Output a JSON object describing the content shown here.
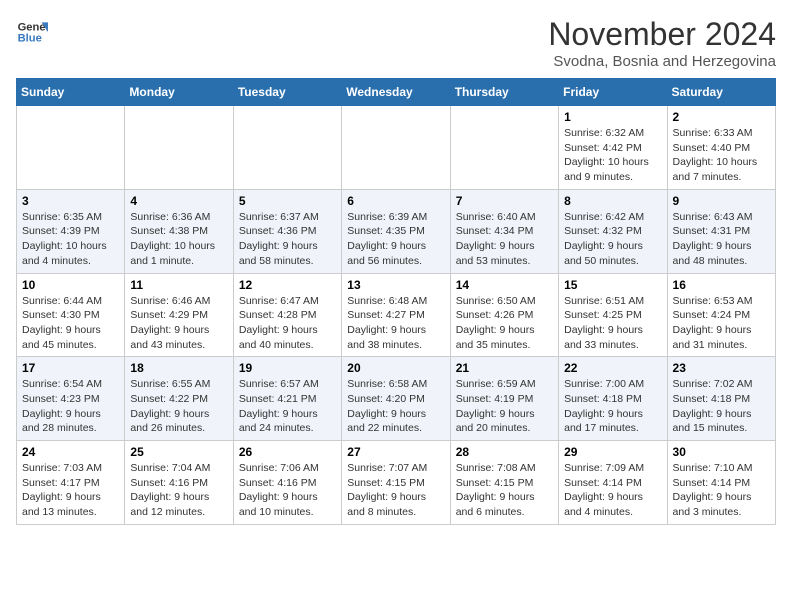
{
  "logo": {
    "line1": "General",
    "line2": "Blue"
  },
  "title": "November 2024",
  "location": "Svodna, Bosnia and Herzegovina",
  "weekdays": [
    "Sunday",
    "Monday",
    "Tuesday",
    "Wednesday",
    "Thursday",
    "Friday",
    "Saturday"
  ],
  "weeks": [
    [
      {
        "day": "",
        "info": ""
      },
      {
        "day": "",
        "info": ""
      },
      {
        "day": "",
        "info": ""
      },
      {
        "day": "",
        "info": ""
      },
      {
        "day": "",
        "info": ""
      },
      {
        "day": "1",
        "info": "Sunrise: 6:32 AM\nSunset: 4:42 PM\nDaylight: 10 hours and 9 minutes."
      },
      {
        "day": "2",
        "info": "Sunrise: 6:33 AM\nSunset: 4:40 PM\nDaylight: 10 hours and 7 minutes."
      }
    ],
    [
      {
        "day": "3",
        "info": "Sunrise: 6:35 AM\nSunset: 4:39 PM\nDaylight: 10 hours and 4 minutes."
      },
      {
        "day": "4",
        "info": "Sunrise: 6:36 AM\nSunset: 4:38 PM\nDaylight: 10 hours and 1 minute."
      },
      {
        "day": "5",
        "info": "Sunrise: 6:37 AM\nSunset: 4:36 PM\nDaylight: 9 hours and 58 minutes."
      },
      {
        "day": "6",
        "info": "Sunrise: 6:39 AM\nSunset: 4:35 PM\nDaylight: 9 hours and 56 minutes."
      },
      {
        "day": "7",
        "info": "Sunrise: 6:40 AM\nSunset: 4:34 PM\nDaylight: 9 hours and 53 minutes."
      },
      {
        "day": "8",
        "info": "Sunrise: 6:42 AM\nSunset: 4:32 PM\nDaylight: 9 hours and 50 minutes."
      },
      {
        "day": "9",
        "info": "Sunrise: 6:43 AM\nSunset: 4:31 PM\nDaylight: 9 hours and 48 minutes."
      }
    ],
    [
      {
        "day": "10",
        "info": "Sunrise: 6:44 AM\nSunset: 4:30 PM\nDaylight: 9 hours and 45 minutes."
      },
      {
        "day": "11",
        "info": "Sunrise: 6:46 AM\nSunset: 4:29 PM\nDaylight: 9 hours and 43 minutes."
      },
      {
        "day": "12",
        "info": "Sunrise: 6:47 AM\nSunset: 4:28 PM\nDaylight: 9 hours and 40 minutes."
      },
      {
        "day": "13",
        "info": "Sunrise: 6:48 AM\nSunset: 4:27 PM\nDaylight: 9 hours and 38 minutes."
      },
      {
        "day": "14",
        "info": "Sunrise: 6:50 AM\nSunset: 4:26 PM\nDaylight: 9 hours and 35 minutes."
      },
      {
        "day": "15",
        "info": "Sunrise: 6:51 AM\nSunset: 4:25 PM\nDaylight: 9 hours and 33 minutes."
      },
      {
        "day": "16",
        "info": "Sunrise: 6:53 AM\nSunset: 4:24 PM\nDaylight: 9 hours and 31 minutes."
      }
    ],
    [
      {
        "day": "17",
        "info": "Sunrise: 6:54 AM\nSunset: 4:23 PM\nDaylight: 9 hours and 28 minutes."
      },
      {
        "day": "18",
        "info": "Sunrise: 6:55 AM\nSunset: 4:22 PM\nDaylight: 9 hours and 26 minutes."
      },
      {
        "day": "19",
        "info": "Sunrise: 6:57 AM\nSunset: 4:21 PM\nDaylight: 9 hours and 24 minutes."
      },
      {
        "day": "20",
        "info": "Sunrise: 6:58 AM\nSunset: 4:20 PM\nDaylight: 9 hours and 22 minutes."
      },
      {
        "day": "21",
        "info": "Sunrise: 6:59 AM\nSunset: 4:19 PM\nDaylight: 9 hours and 20 minutes."
      },
      {
        "day": "22",
        "info": "Sunrise: 7:00 AM\nSunset: 4:18 PM\nDaylight: 9 hours and 17 minutes."
      },
      {
        "day": "23",
        "info": "Sunrise: 7:02 AM\nSunset: 4:18 PM\nDaylight: 9 hours and 15 minutes."
      }
    ],
    [
      {
        "day": "24",
        "info": "Sunrise: 7:03 AM\nSunset: 4:17 PM\nDaylight: 9 hours and 13 minutes."
      },
      {
        "day": "25",
        "info": "Sunrise: 7:04 AM\nSunset: 4:16 PM\nDaylight: 9 hours and 12 minutes."
      },
      {
        "day": "26",
        "info": "Sunrise: 7:06 AM\nSunset: 4:16 PM\nDaylight: 9 hours and 10 minutes."
      },
      {
        "day": "27",
        "info": "Sunrise: 7:07 AM\nSunset: 4:15 PM\nDaylight: 9 hours and 8 minutes."
      },
      {
        "day": "28",
        "info": "Sunrise: 7:08 AM\nSunset: 4:15 PM\nDaylight: 9 hours and 6 minutes."
      },
      {
        "day": "29",
        "info": "Sunrise: 7:09 AM\nSunset: 4:14 PM\nDaylight: 9 hours and 4 minutes."
      },
      {
        "day": "30",
        "info": "Sunrise: 7:10 AM\nSunset: 4:14 PM\nDaylight: 9 hours and 3 minutes."
      }
    ]
  ]
}
